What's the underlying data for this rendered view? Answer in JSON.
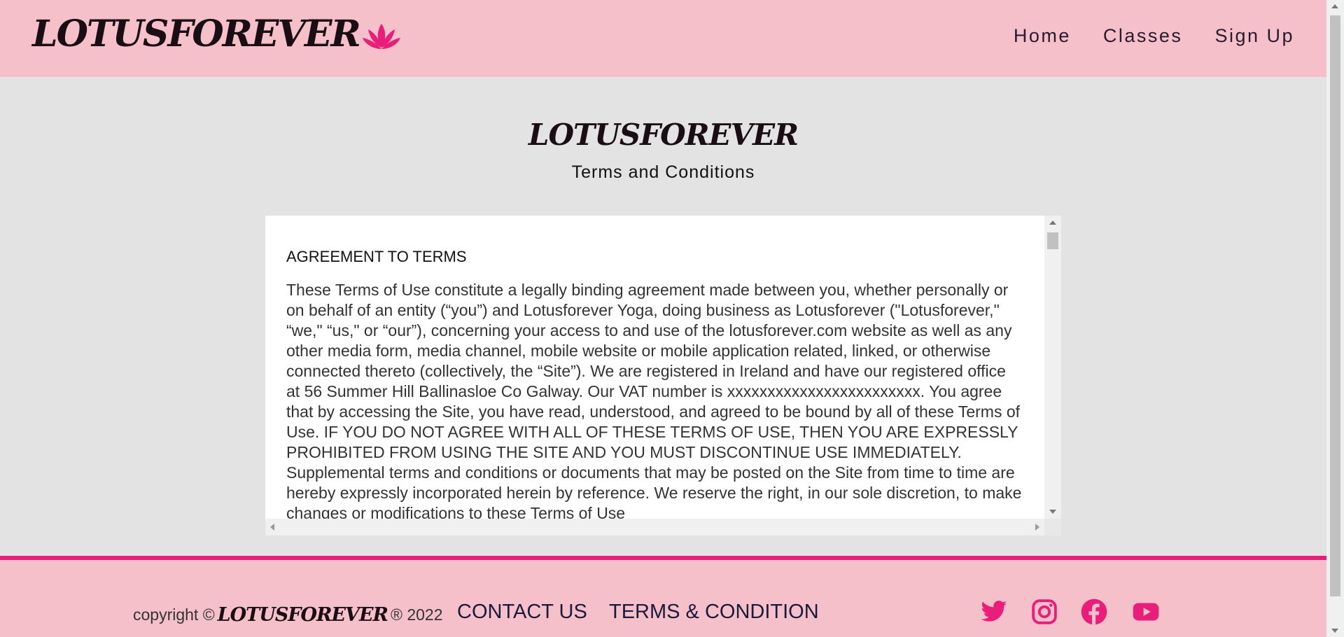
{
  "header": {
    "logo_text": "LOTUSFOREVER",
    "nav": [
      {
        "label": "Home"
      },
      {
        "label": "Classes"
      },
      {
        "label": "Sign Up"
      }
    ]
  },
  "main": {
    "brand": "LOTUSFOREVER",
    "subtitle": "Terms and Conditions",
    "terms_heading": "AGREEMENT TO TERMS",
    "terms_body": "These Terms of Use constitute a legally binding agreement made between you, whether personally or on behalf of an entity (“you”) and Lotusforever Yoga, doing business as Lotusforever (\"Lotusforever,\" “we,\" “us,\" or “our”), concerning your access to and use of the lotusforever.com website as well as any other media form, media channel, mobile website or mobile application related, linked, or otherwise connected thereto (collectively, the “Site”). We are registered in Ireland and have our registered office at 56 Summer Hill Ballinasloe Co Galway. Our VAT number is xxxxxxxxxxxxxxxxxxxxxxxx. You agree that by accessing the Site, you have read, understood, and agreed to be bound by all of these Terms of Use. IF YOU DO NOT AGREE WITH ALL OF THESE TERMS OF USE, THEN YOU ARE EXPRESSLY PROHIBITED FROM USING THE SITE AND YOU MUST DISCONTINUE USE IMMEDIATELY. Supplemental terms and conditions or documents that may be posted on the Site from time to time are hereby expressly incorporated herein by reference. We reserve the right, in our sole discretion, to make changes or modifications to these Terms of Use"
  },
  "footer": {
    "copyright_prefix": "copyright ©",
    "copyright_brand": "LOTUSFOREVER",
    "copyright_suffix": "® 2022",
    "contact_label": "CONTACT US",
    "terms_label": "TERMS & CONDITION",
    "social": [
      "twitter-icon",
      "instagram-icon",
      "facebook-icon",
      "youtube-icon"
    ]
  },
  "colors": {
    "header_bg": "#f5c0c9",
    "accent": "#e91e7a",
    "page_bg": "#e3e3e3"
  }
}
